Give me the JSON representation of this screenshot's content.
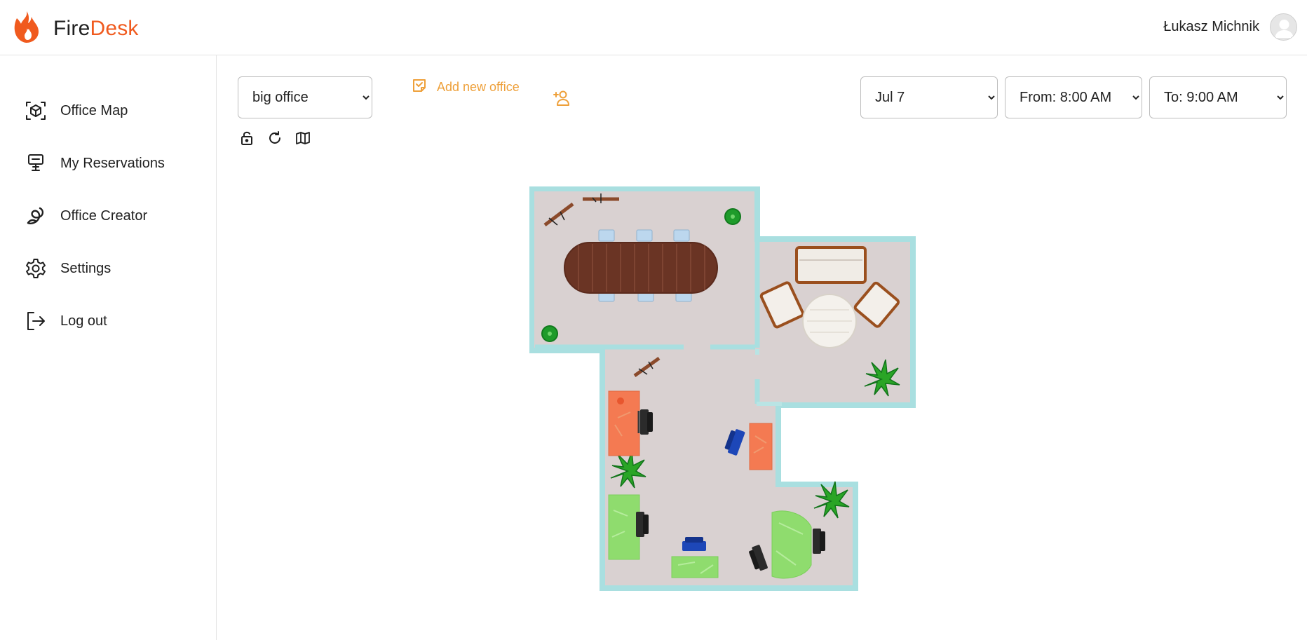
{
  "app": {
    "brand_part1": "Fire",
    "brand_part2": "Desk",
    "brand_color": "#f05a1e",
    "logo_icon": "flame-icon"
  },
  "user": {
    "name": "Łukasz Michnik",
    "avatar_icon": "user-avatar-icon"
  },
  "sidebar": {
    "items": [
      {
        "label": "Office Map",
        "icon": "cube-scan-icon"
      },
      {
        "label": "My Reservations",
        "icon": "desk-icon"
      },
      {
        "label": "Office Creator",
        "icon": "creator-swirl-icon"
      },
      {
        "label": "Settings",
        "icon": "gear-icon"
      },
      {
        "label": "Log out",
        "icon": "logout-icon"
      }
    ]
  },
  "toolbar": {
    "office_select": {
      "value": "big office",
      "options": [
        "big office"
      ]
    },
    "add_office_label": "Add new office",
    "add_office_icon": "add-office-icon",
    "add_user_icon": "add-user-icon",
    "date_select": {
      "value": "Jul 7",
      "options": [
        "Jul 7"
      ]
    },
    "from_select": {
      "value": "From: 8:00 AM",
      "options": [
        "From: 8:00 AM"
      ]
    },
    "to_select": {
      "value": "To: 9:00 AM",
      "options": [
        "To: 9:00 AM"
      ]
    },
    "accent_color": "#eea03a"
  },
  "map_tools": [
    "lock-icon",
    "refresh-icon",
    "map-icon"
  ],
  "floor_plan": {
    "desk_status_colors": {
      "reserved": "#f47a52",
      "available": "#8fdc6e"
    },
    "wall_color": "#a9dfe0",
    "floor_color": "#d9d1d1"
  }
}
